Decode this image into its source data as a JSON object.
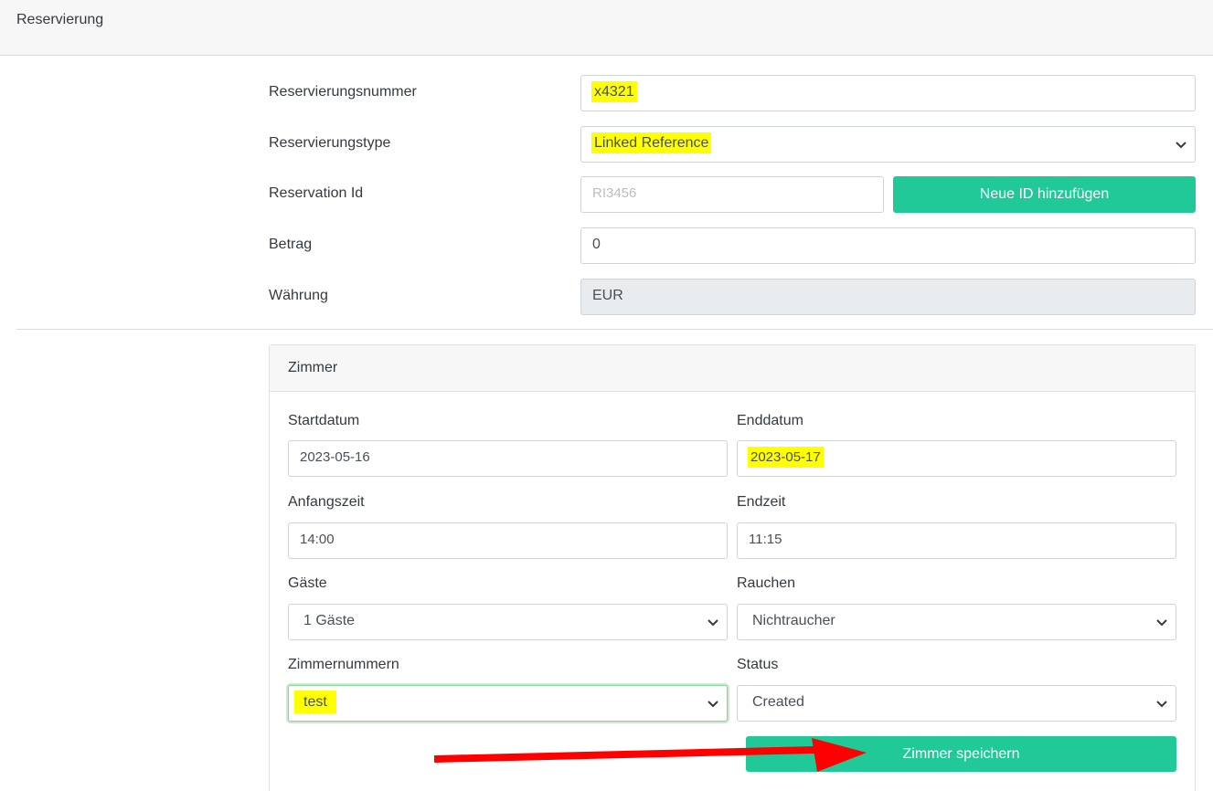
{
  "header": {
    "title": "Reservierung"
  },
  "form": {
    "reservation_number": {
      "label": "Reservierungsnummer",
      "value": "x4321"
    },
    "reservation_type": {
      "label": "Reservierungstype",
      "value": "Linked Reference"
    },
    "reservation_id": {
      "label": "Reservation Id",
      "placeholder": "RI3456",
      "button": "Neue ID hinzufügen"
    },
    "amount": {
      "label": "Betrag",
      "value": "0"
    },
    "currency": {
      "label": "Währung",
      "value": "EUR"
    }
  },
  "room": {
    "title": "Zimmer",
    "start_date": {
      "label": "Startdatum",
      "value": "2023-05-16"
    },
    "end_date": {
      "label": "Enddatum",
      "value": "2023-05-17"
    },
    "start_time": {
      "label": "Anfangszeit",
      "value": "14:00"
    },
    "end_time": {
      "label": "Endzeit",
      "value": "11:15"
    },
    "guests": {
      "label": "Gäste",
      "value": "1 Gäste"
    },
    "smoking": {
      "label": "Rauchen",
      "value": "Nichtraucher"
    },
    "room_numbers": {
      "label": "Zimmernummern",
      "value": "test"
    },
    "status": {
      "label": "Status",
      "value": "Created"
    },
    "save_button": "Zimmer speichern"
  },
  "colors": {
    "accent": "#20c997",
    "highlight": "#ffff00",
    "annotation_arrow": "#ff0000"
  },
  "icons": {
    "select_chevron": "chevron-down-icon",
    "annotation": "red-arrow-icon"
  }
}
